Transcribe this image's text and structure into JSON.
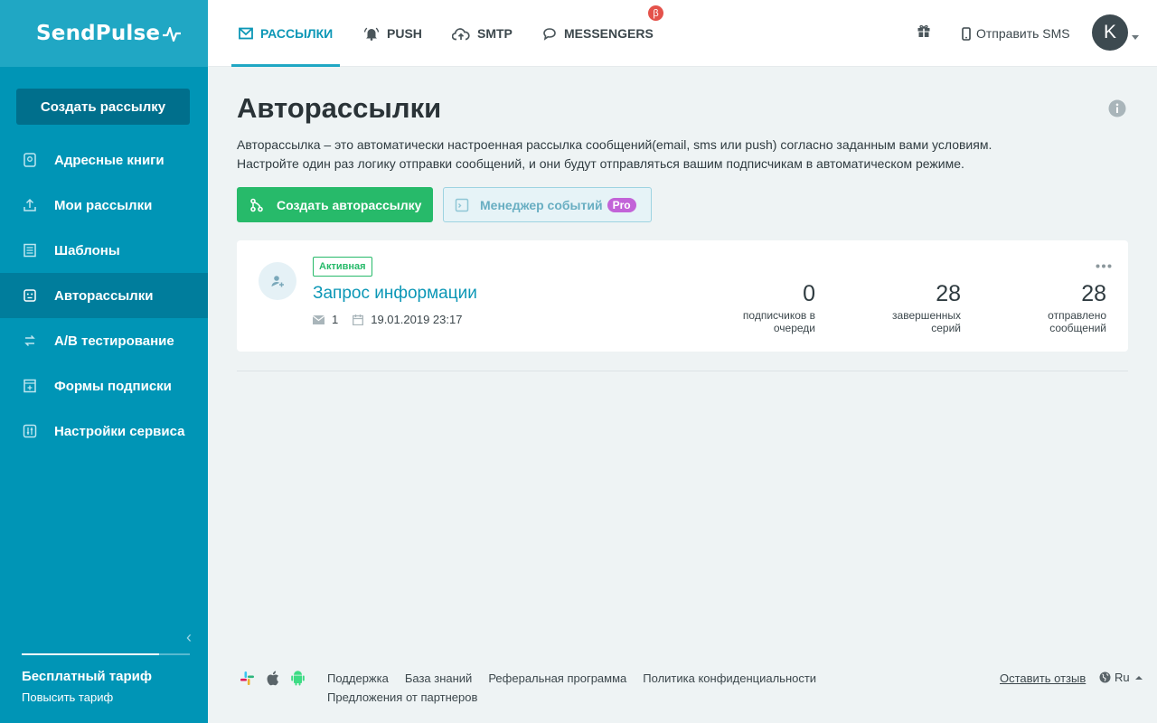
{
  "app": {
    "logo": "SendPulse"
  },
  "sidebar": {
    "create_button": "Создать рассылку",
    "items": [
      {
        "label": "Адресные книги",
        "icon": "address-book-icon"
      },
      {
        "label": "Мои рассылки",
        "icon": "upload-icon"
      },
      {
        "label": "Шаблоны",
        "icon": "template-icon"
      },
      {
        "label": "Авторассылки",
        "icon": "robot-icon",
        "active": true
      },
      {
        "label": "A/B тестирование",
        "icon": "ab-test-icon"
      },
      {
        "label": "Формы подписки",
        "icon": "form-icon"
      },
      {
        "label": "Настройки сервиса",
        "icon": "settings-sliders-icon"
      }
    ],
    "plan_title": "Бесплатный тариф",
    "plan_upgrade": "Повысить тариф"
  },
  "topbar": {
    "tabs": [
      {
        "label": "РАССЫЛКИ",
        "icon": "envelope-icon",
        "active": true
      },
      {
        "label": "PUSH",
        "icon": "bell-icon"
      },
      {
        "label": "SMTP",
        "icon": "cloud-upload-icon"
      },
      {
        "label": "MESSENGERS",
        "icon": "chat-bubble-icon"
      }
    ],
    "beta_badge": "β",
    "sms_label": "Отправить SMS",
    "avatar_letter": "K"
  },
  "main": {
    "title": "Авторассылки",
    "description_line1": "Авторассылка – это автоматически настроенная рассылка сообщений(email, sms или push) согласно заданным вами условиям.",
    "description_line2": "Настройте один раз логику отправки сообщений, и они будут отправляться вашим подписчикам в автоматическом режиме.",
    "create_button": "Создать авторассылку",
    "events_button": "Менеджер событий",
    "pro_badge": "Pro"
  },
  "card": {
    "status": "Активная",
    "title": "Запрос информации",
    "letters_count": "1",
    "date": "19.01.2019 23:17",
    "stats": [
      {
        "value": "0",
        "label_line1": "подписчиков в",
        "label_line2": "очереди"
      },
      {
        "value": "28",
        "label_line1": "завершенных",
        "label_line2": "серий"
      },
      {
        "value": "28",
        "label_line1": "отправлено",
        "label_line2": "сообщений"
      }
    ]
  },
  "footer": {
    "links_row1": [
      "Поддержка",
      "База знаний",
      "Реферальная программа",
      "Политика конфиденциальности"
    ],
    "links_row2": [
      "Предложения от партнеров"
    ],
    "feedback": "Оставить отзыв",
    "language": "Ru"
  },
  "colors": {
    "brand": "#0095b6",
    "accent": "#20a7c4",
    "green": "#27ba6a",
    "pro": "#c263d8",
    "beta": "#e4524b"
  }
}
